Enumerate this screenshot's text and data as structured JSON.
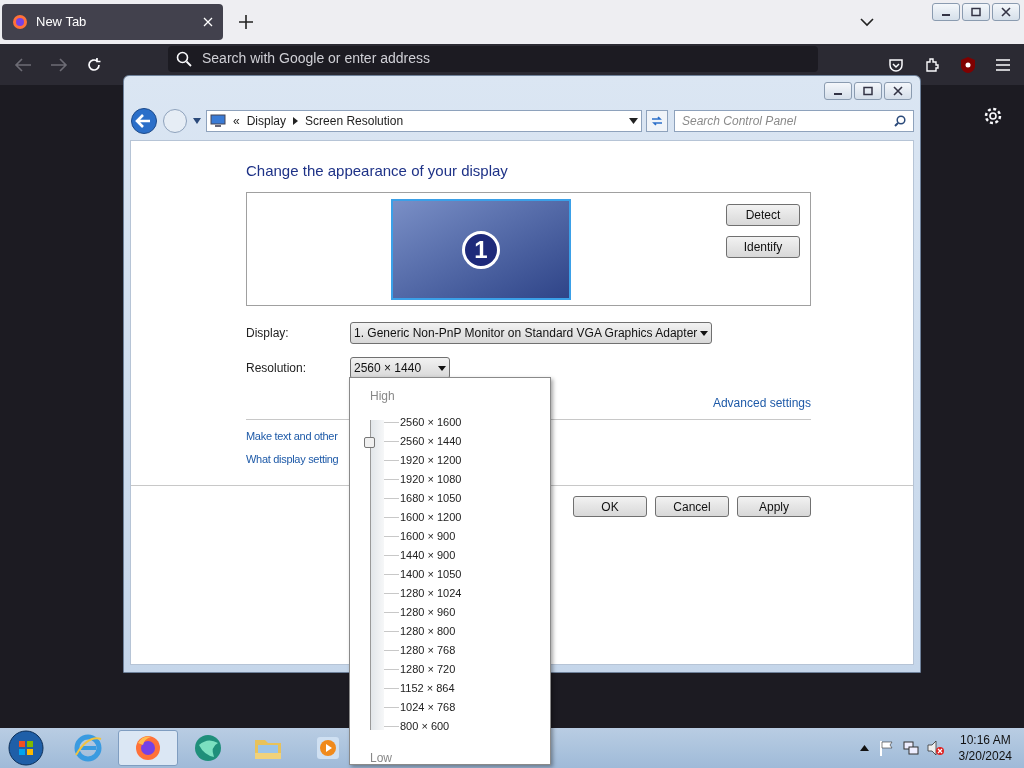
{
  "browser": {
    "tabs": [
      {
        "title": "New Tab",
        "selected": true
      }
    ],
    "address_placeholder": "Search with Google or enter address"
  },
  "window": {
    "breadcrumb_prefix": "«",
    "breadcrumb": [
      "Display",
      "Screen Resolution"
    ],
    "search_placeholder": "Search Control Panel"
  },
  "content": {
    "heading": "Change the appearance of your display",
    "monitor_number": "1",
    "side_buttons": [
      "Detect",
      "Identify"
    ],
    "display": {
      "label": "Display:",
      "value": "1. Generic Non-PnP Monitor on Standard VGA Graphics Adapter"
    },
    "resolution": {
      "label": "Resolution:",
      "value": "2560 × 1440"
    },
    "advanced_link": "Advanced settings",
    "links": [
      "Make text and other",
      "What display setting"
    ],
    "dialog_buttons": [
      "OK",
      "Cancel",
      "Apply"
    ]
  },
  "resolution_popup": {
    "high_label": "High",
    "low_label": "Low",
    "level": 0.9375,
    "options": [
      "2560 × 1600",
      "2560 × 1440",
      "1920 × 1200",
      "1920 × 1080",
      "1680 × 1050",
      "1600 × 1200",
      "1600 × 900",
      "1440 × 900",
      "1400 × 1050",
      "1280 × 1024",
      "1280 × 960",
      "1280 × 800",
      "1280 × 768",
      "1280 × 720",
      "1152 × 864",
      "1024 × 768",
      "800 × 600"
    ]
  },
  "taskbar": {
    "apps": [
      {
        "kind": "ie",
        "selected": false
      },
      {
        "kind": "firefox",
        "selected": true
      },
      {
        "kind": "globe",
        "selected": false
      },
      {
        "kind": "folder",
        "selected": false
      },
      {
        "kind": "media",
        "selected": false
      }
    ],
    "time": "10:16 AM",
    "date": "3/20/2024"
  }
}
